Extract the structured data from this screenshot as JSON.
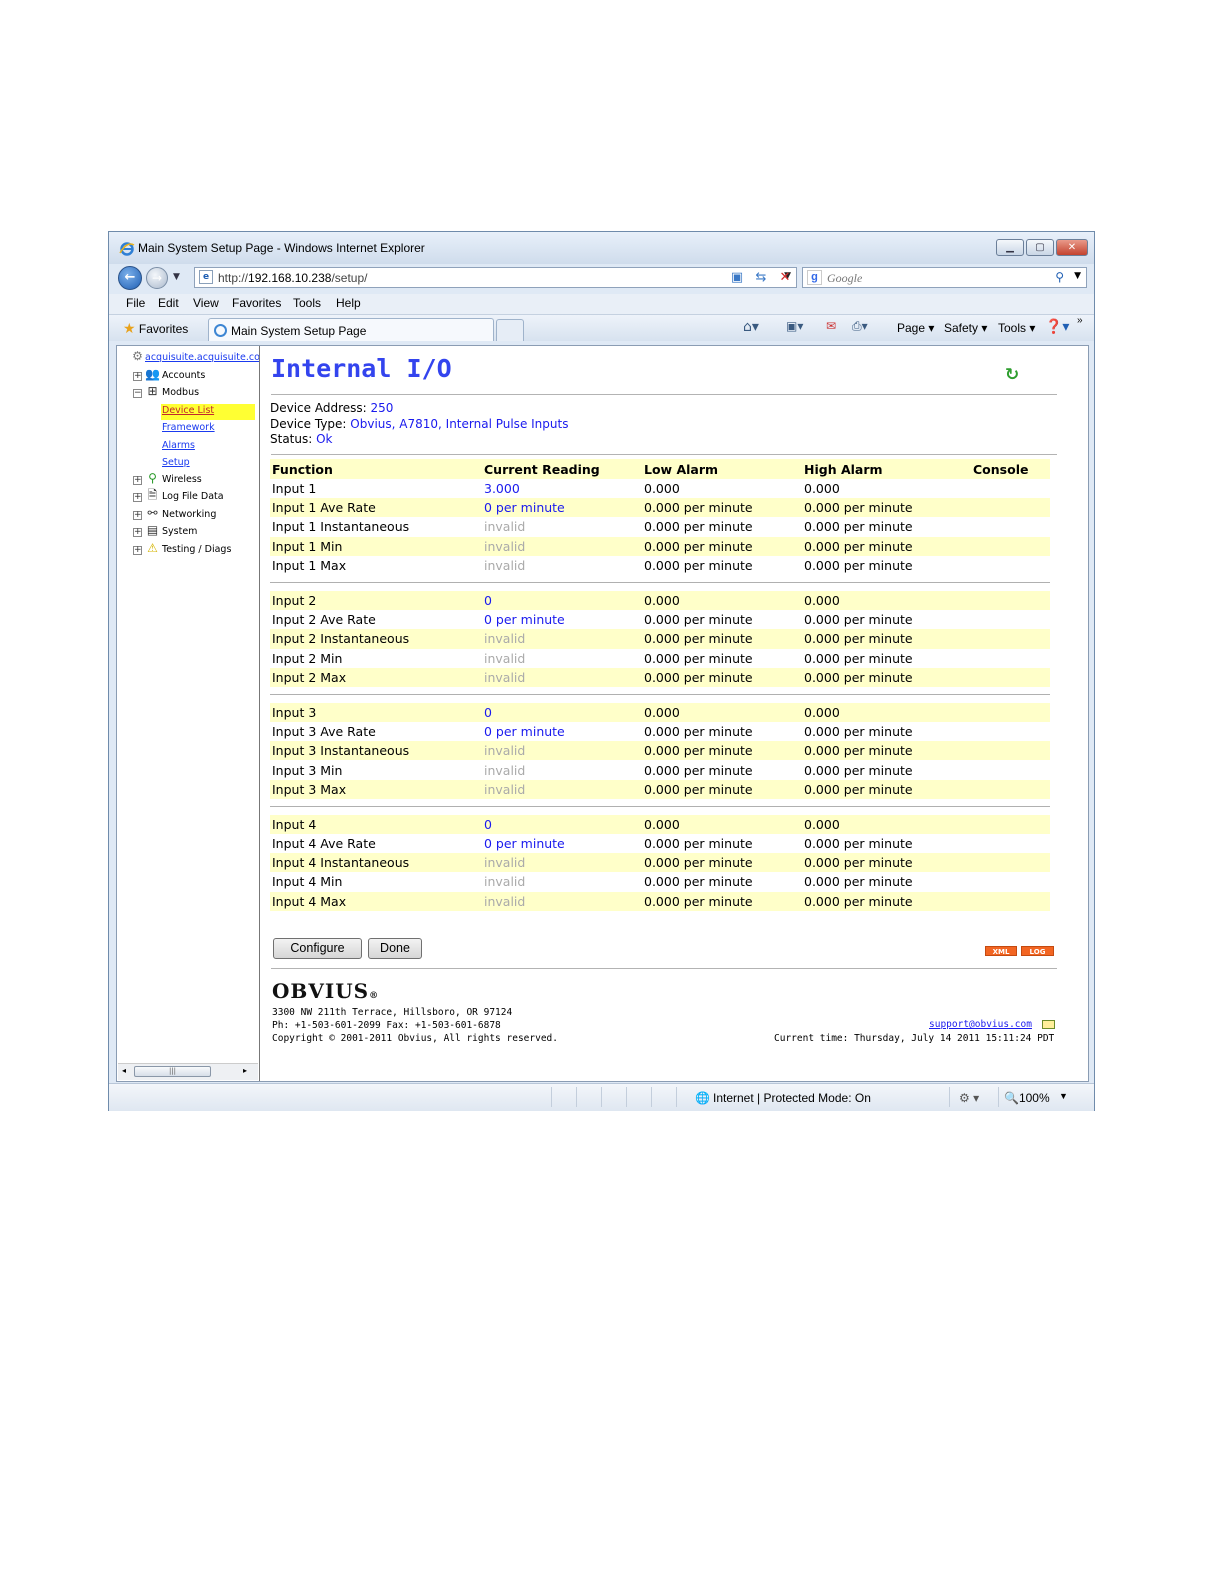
{
  "window": {
    "title": "Main System Setup Page - Windows Internet Explorer"
  },
  "navigation": {
    "url_prefix": "http://",
    "url_host": "192.168.10.238",
    "url_path": "/setup/",
    "search_placeholder": "Google"
  },
  "menu": [
    "File",
    "Edit",
    "View",
    "Favorites",
    "Tools",
    "Help"
  ],
  "favorites_bar": {
    "favorites_label": "Favorites",
    "tab_title": "Main System Setup Page",
    "commands": [
      "Page",
      "Safety",
      "Tools"
    ]
  },
  "sidebar": {
    "root": "acquisuite.acquisuite.cor",
    "items": [
      {
        "label": "Accounts",
        "icon": "accounts-icon"
      },
      {
        "label": "Modbus",
        "icon": "modbus-icon"
      },
      {
        "label": "Device List"
      },
      {
        "label": "Framework"
      },
      {
        "label": "Alarms"
      },
      {
        "label": "Setup"
      },
      {
        "label": "Wireless",
        "icon": "wireless-icon"
      },
      {
        "label": "Log File Data",
        "icon": "log-file-icon"
      },
      {
        "label": "Networking",
        "icon": "networking-icon"
      },
      {
        "label": "System",
        "icon": "system-icon"
      },
      {
        "label": "Testing / Diags",
        "icon": "testing-icon"
      }
    ]
  },
  "page": {
    "title": "Internal I/O",
    "device_address_label": "Device Address:",
    "device_address": "250",
    "device_type_label": "Device Type:",
    "device_type": "Obvius, A7810, Internal Pulse Inputs",
    "status_label": "Status:",
    "status": "Ok"
  },
  "table": {
    "headers": [
      "Function",
      "Current Reading",
      "Low Alarm",
      "High Alarm",
      "Console"
    ],
    "groups": [
      [
        {
          "fn": "Input 1",
          "reading": "3.000",
          "low": "0.000",
          "high": "0.000"
        },
        {
          "fn": "Input 1 Ave Rate",
          "reading": "0 per minute",
          "low": "0.000 per minute",
          "high": "0.000 per minute"
        },
        {
          "fn": "Input 1 Instantaneous",
          "reading": "invalid",
          "low": "0.000 per minute",
          "high": "0.000 per minute"
        },
        {
          "fn": "Input 1 Min",
          "reading": "invalid",
          "low": "0.000 per minute",
          "high": "0.000 per minute"
        },
        {
          "fn": "Input 1 Max",
          "reading": "invalid",
          "low": "0.000 per minute",
          "high": "0.000 per minute"
        }
      ],
      [
        {
          "fn": "Input 2",
          "reading": "0",
          "low": "0.000",
          "high": "0.000"
        },
        {
          "fn": "Input 2 Ave Rate",
          "reading": "0 per minute",
          "low": "0.000 per minute",
          "high": "0.000 per minute"
        },
        {
          "fn": "Input 2 Instantaneous",
          "reading": "invalid",
          "low": "0.000 per minute",
          "high": "0.000 per minute"
        },
        {
          "fn": "Input 2 Min",
          "reading": "invalid",
          "low": "0.000 per minute",
          "high": "0.000 per minute"
        },
        {
          "fn": "Input 2 Max",
          "reading": "invalid",
          "low": "0.000 per minute",
          "high": "0.000 per minute"
        }
      ],
      [
        {
          "fn": "Input 3",
          "reading": "0",
          "low": "0.000",
          "high": "0.000"
        },
        {
          "fn": "Input 3 Ave Rate",
          "reading": "0 per minute",
          "low": "0.000 per minute",
          "high": "0.000 per minute"
        },
        {
          "fn": "Input 3 Instantaneous",
          "reading": "invalid",
          "low": "0.000 per minute",
          "high": "0.000 per minute"
        },
        {
          "fn": "Input 3 Min",
          "reading": "invalid",
          "low": "0.000 per minute",
          "high": "0.000 per minute"
        },
        {
          "fn": "Input 3 Max",
          "reading": "invalid",
          "low": "0.000 per minute",
          "high": "0.000 per minute"
        }
      ],
      [
        {
          "fn": "Input 4",
          "reading": "0",
          "low": "0.000",
          "high": "0.000"
        },
        {
          "fn": "Input 4 Ave Rate",
          "reading": "0 per minute",
          "low": "0.000 per minute",
          "high": "0.000 per minute"
        },
        {
          "fn": "Input 4 Instantaneous",
          "reading": "invalid",
          "low": "0.000 per minute",
          "high": "0.000 per minute"
        },
        {
          "fn": "Input 4 Min",
          "reading": "invalid",
          "low": "0.000 per minute",
          "high": "0.000 per minute"
        },
        {
          "fn": "Input 4 Max",
          "reading": "invalid",
          "low": "0.000 per minute",
          "high": "0.000 per minute"
        }
      ]
    ]
  },
  "actions": {
    "configure": "Configure",
    "done": "Done",
    "xml_badge": "XML",
    "log_badge": "LOG"
  },
  "footer": {
    "logo": "OBVIUS",
    "address": "3300 NW 211th Terrace, Hillsboro, OR 97124",
    "phone": "Ph: +1-503-601-2099 Fax: +1-503-601-6878",
    "copyright": "Copyright © 2001-2011 Obvius, All rights reserved.",
    "support_email": "support@obvius.com",
    "current_time": "Current time: Thursday, July 14 2011 15:11:24 PDT"
  },
  "statusbar": {
    "zone": "Internet | Protected Mode: On",
    "zoom": "100%"
  },
  "colors": {
    "title_blue": "#3344ee",
    "link_blue": "#1a1aee",
    "row_highlight": "#ffffc9",
    "selected_tree": "#ffff33",
    "badge_orange": "#f26522"
  }
}
